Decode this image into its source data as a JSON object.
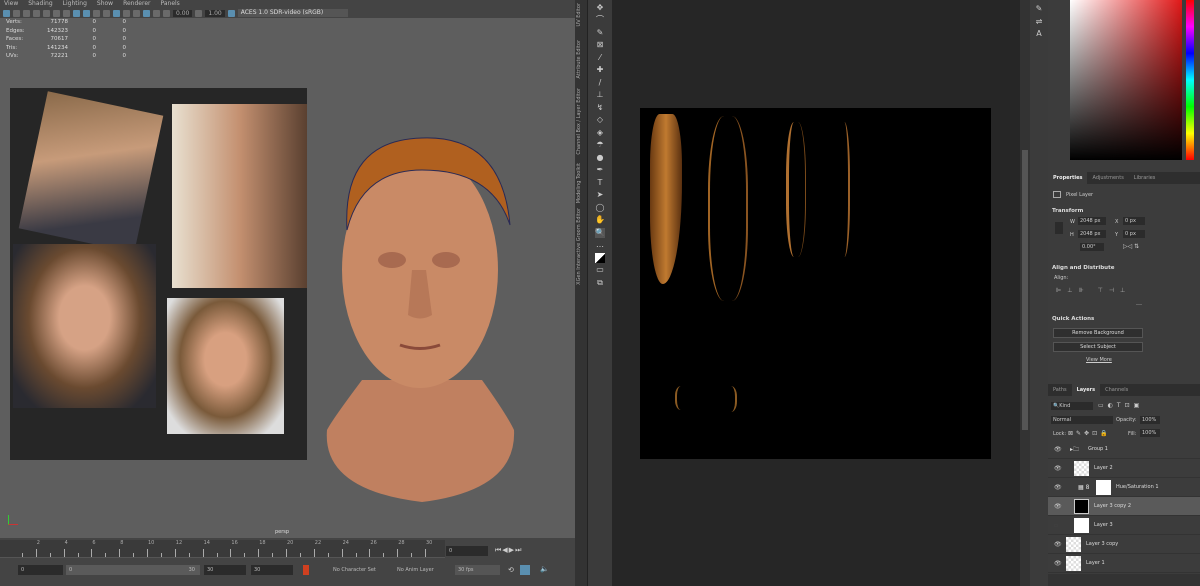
{
  "maya": {
    "menu": [
      "View",
      "Shading",
      "Lighting",
      "Show",
      "Renderer",
      "Panels"
    ],
    "toolbar": {
      "exposure": "0.00",
      "gamma": "1.00",
      "colorspace": "ACES 1.0 SDR-video (sRGB)"
    },
    "stats": [
      [
        "Verts:",
        "71778",
        "0",
        "0"
      ],
      [
        "Edges:",
        "142323",
        "0",
        "0"
      ],
      [
        "Faces:",
        "70617",
        "0",
        "0"
      ],
      [
        "Tris:",
        "141234",
        "0",
        "0"
      ],
      [
        "UVs:",
        "72221",
        "0",
        "0"
      ]
    ],
    "camera": "persp",
    "timeline": {
      "ticks": [
        "2",
        "4",
        "6",
        "8",
        "10",
        "12",
        "14",
        "16",
        "18",
        "20",
        "22",
        "24",
        "26",
        "28",
        "30"
      ],
      "current_frame": "0",
      "start": "0",
      "range_start": "0",
      "range_end": "30",
      "end1": "30",
      "end2": "30",
      "character_set": "No Character Set",
      "anim_layer": "No Anim Layer",
      "fps": "30 fps"
    }
  },
  "side_tabs": [
    "UV Editor",
    "Attribute Editor",
    "Channel Box / Layer Editor",
    "Modeling Toolkit",
    "XGen Interactive Groom Editor"
  ],
  "ps": {
    "properties": {
      "tabs": [
        "Properties",
        "Adjustments",
        "Libraries"
      ],
      "layer_type": "Pixel Layer",
      "transform_title": "Transform",
      "w": "2048 px",
      "h": "2048 px",
      "x": "0 px",
      "y": "0 px",
      "angle": "0.00°",
      "align_title": "Align and Distribute",
      "align_label": "Align:",
      "quick_title": "Quick Actions",
      "remove_bg": "Remove Background",
      "select_subject": "Select Subject",
      "view_more": "View More"
    },
    "layers": {
      "tabs": [
        "Paths",
        "Layers",
        "Channels"
      ],
      "filter": "Kind",
      "blend": "Normal",
      "opacity_label": "Opacity:",
      "opacity": "100%",
      "lock_label": "Lock:",
      "fill_label": "Fill:",
      "fill": "100%",
      "items": [
        {
          "name": "Group 1"
        },
        {
          "name": "Layer 2"
        },
        {
          "name": "Hue/Saturation 1"
        },
        {
          "name": "Layer 3 copy 2"
        },
        {
          "name": "Layer 3"
        },
        {
          "name": "Layer 3 copy"
        },
        {
          "name": "Layer 1"
        }
      ]
    }
  }
}
